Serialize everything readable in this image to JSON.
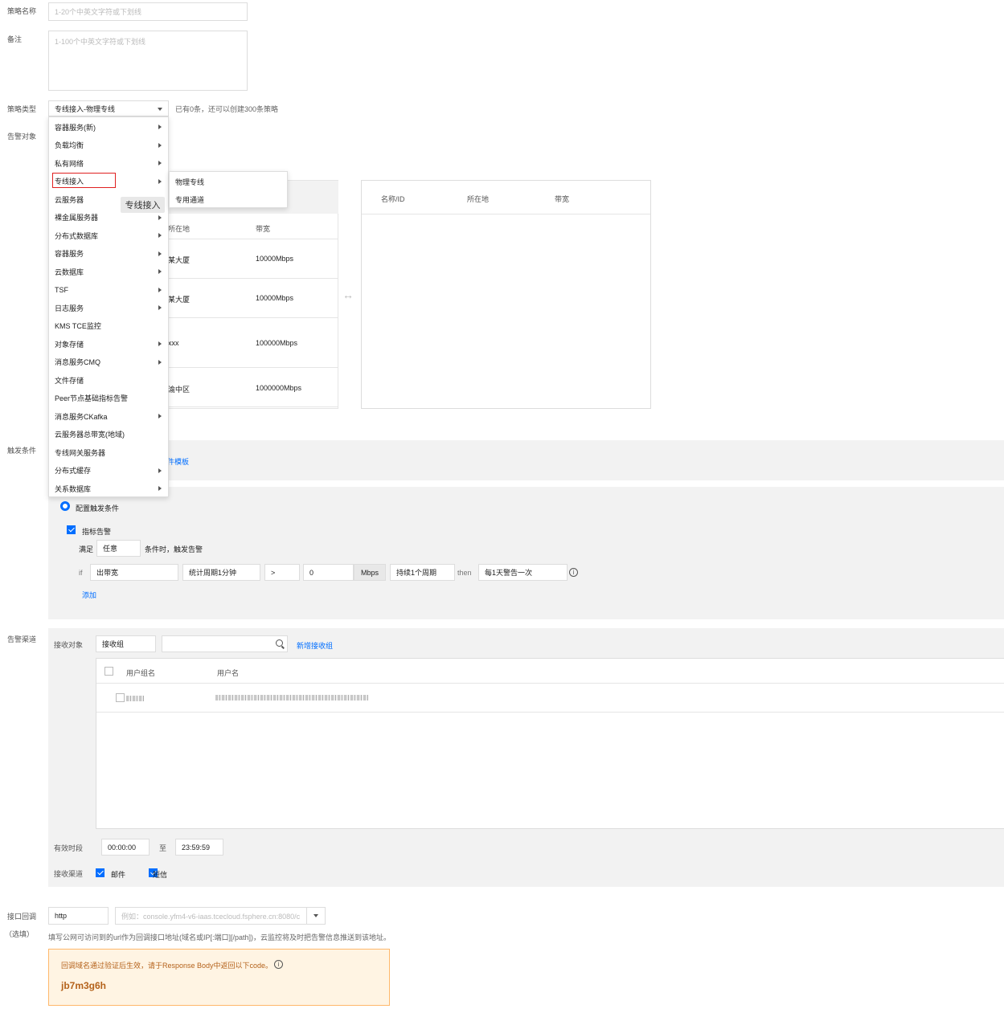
{
  "form": {
    "policy_name_label": "策略名称",
    "policy_name_placeholder": "1-20个中英文字符或下划线",
    "remark_label": "备注",
    "remark_placeholder": "1-100个中英文字符或下划线",
    "policy_type_label": "策略类型",
    "policy_type_value": "专线接入-物理专线",
    "policy_type_hint": "已有0条，还可以创建300条策略",
    "alarm_object_label": "告警对象",
    "trigger_label": "触发条件",
    "channel_label": "告警渠道",
    "callback_label": "接口回调",
    "callback_optional": "（选填）"
  },
  "type_menu": {
    "items": [
      {
        "label": "容器服务(新)",
        "sub": true
      },
      {
        "label": "负载均衡",
        "sub": true
      },
      {
        "label": "私有网络",
        "sub": true
      },
      {
        "label": "专线接入",
        "sub": true
      },
      {
        "label": "云服务器",
        "sub": true
      },
      {
        "label": "裸金属服务器",
        "sub": true
      },
      {
        "label": "分布式数据库",
        "sub": true
      },
      {
        "label": "容器服务",
        "sub": true
      },
      {
        "label": "云数据库",
        "sub": true
      },
      {
        "label": "TSF",
        "sub": true
      },
      {
        "label": "日志服务",
        "sub": true
      },
      {
        "label": "KMS TCE监控",
        "sub": false
      },
      {
        "label": "对象存储",
        "sub": true
      },
      {
        "label": "消息服务CMQ",
        "sub": true
      },
      {
        "label": "文件存储",
        "sub": false
      },
      {
        "label": "Peer节点基础指标告警",
        "sub": false
      },
      {
        "label": "消息服务CKafka",
        "sub": true
      },
      {
        "label": "云服务器总带宽(地域)",
        "sub": false
      },
      {
        "label": "专线网关服务器",
        "sub": false
      },
      {
        "label": "分布式缓存",
        "sub": true
      },
      {
        "label": "关系数据库",
        "sub": true
      }
    ],
    "tooltip": "专线接入",
    "submenu": [
      "物理专线",
      "专用通道"
    ]
  },
  "left_table": {
    "headers": [
      "所在地",
      "带宽"
    ],
    "rows": [
      {
        "location": "某大厦",
        "bandwidth": "10000Mbps"
      },
      {
        "location": "某大厦",
        "bandwidth": "10000Mbps"
      },
      {
        "location": "xxx",
        "bandwidth": "100000Mbps"
      },
      {
        "location": "渝中区",
        "bandwidth": "1000000Mbps"
      }
    ]
  },
  "transfer_icon": "↔",
  "right_table": {
    "headers": [
      "名称/ID",
      "所在地",
      "带宽"
    ]
  },
  "trigger": {
    "template_link": "件模板",
    "config_radio": "配置触发条件",
    "metric_alarm": "指标告警",
    "meet": "满足",
    "meet_value": "任意",
    "meet_suffix": "条件时，触发告警",
    "if": "if",
    "metric": "出带宽",
    "period": "统计周期1分钟",
    "operator": ">",
    "threshold": "0",
    "unit": "Mbps",
    "duration": "持续1个周期",
    "then": "then",
    "frequency": "每1天警告一次",
    "add": "添加"
  },
  "channel": {
    "receiver_label": "接收对象",
    "receiver_type": "接收组",
    "new_group": "新增接收组",
    "col_group": "用户组名",
    "col_user": "用户名",
    "time_label": "有效时段",
    "time_start": "00:00:00",
    "time_to": "至",
    "time_end": "23:59:59",
    "method_label": "接收渠道",
    "email": "邮件",
    "sms": "短信"
  },
  "callback": {
    "protocol": "http",
    "url_placeholder": "例如：console.yfm4-v6-iaas.tcecloud.fsphere.cn:8080/c",
    "hint": "填写公网可访问到的url作为回调接口地址(域名或IP[:端口][/path])，云监控将及时把告警信息推送到该地址。",
    "notice": "回调域名通过验证后生效，请于Response Body中返回以下code。",
    "code": "jb7m3g6h"
  }
}
